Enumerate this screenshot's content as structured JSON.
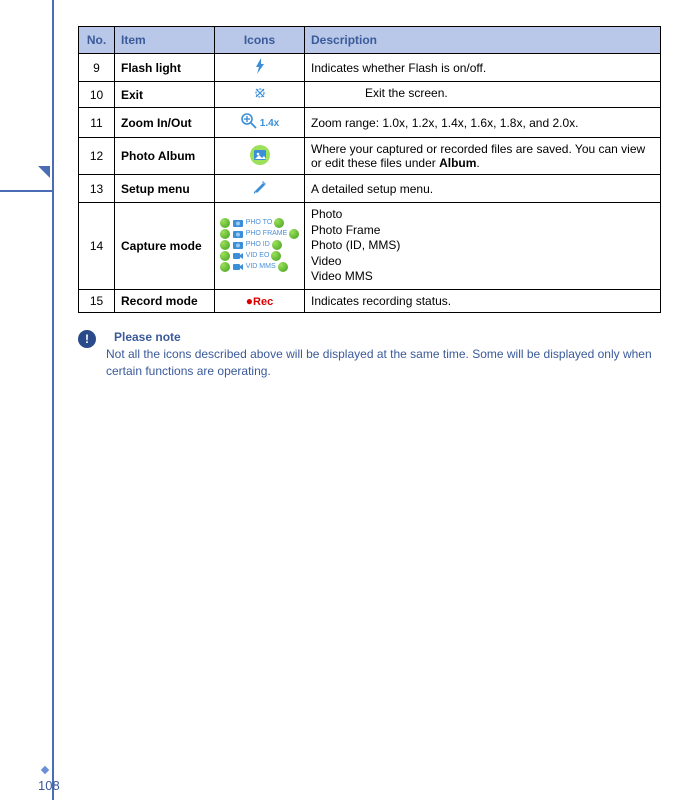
{
  "table": {
    "headers": {
      "no": "No.",
      "item": "Item",
      "icons": "Icons",
      "description": "Description"
    },
    "rows": [
      {
        "no": "9",
        "item": "Flash light",
        "desc": "Indicates whether Flash is on/off."
      },
      {
        "no": "10",
        "item": "Exit",
        "desc": "Exit the screen."
      },
      {
        "no": "11",
        "item": "Zoom In/Out",
        "zoom": "1.4x",
        "desc": "Zoom range: 1.0x, 1.2x, 1.4x, 1.6x, 1.8x, and 2.0x."
      },
      {
        "no": "12",
        "item": "Photo Album",
        "desc_pre": "Where your captured or recorded files are saved. You can view or edit these files under ",
        "desc_bold": "Album",
        "desc_post": "."
      },
      {
        "no": "13",
        "item": "Setup menu",
        "desc": "A detailed setup menu."
      },
      {
        "no": "14",
        "item": "Capture mode",
        "modes": [
          "Photo",
          "Photo Frame",
          "Photo (ID, MMS)",
          "Video",
          "Video MMS"
        ],
        "caps": [
          "PHO TO",
          "PHO FRAME",
          "PHO ID",
          "VID EO",
          "VID MMS"
        ]
      },
      {
        "no": "15",
        "item": "Record mode",
        "rec": "Rec",
        "desc": "Indicates recording status."
      }
    ]
  },
  "note": {
    "title": "Please note",
    "body": "Not all the icons described above will be displayed at the same time.   Some will be displayed only when certain functions are operating."
  },
  "page_number": "108"
}
